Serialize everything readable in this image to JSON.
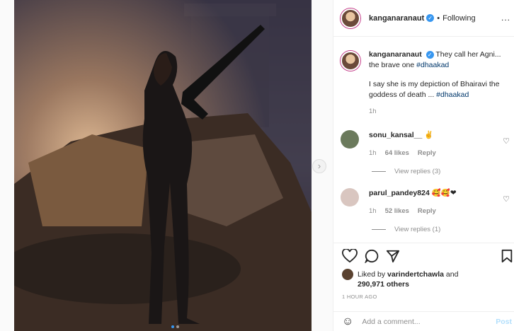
{
  "header": {
    "username": "kanganaranaut",
    "separator": "•",
    "follow_state": "Following",
    "more": "..."
  },
  "caption": {
    "username": "kanganaranaut",
    "text1": "They call her Agni... the brave one",
    "hashtag1": "#dhaakad",
    "text2": "I say she is my depiction of Bhairavi the goddess of death ...",
    "hashtag2": "#dhaakad",
    "time": "1h"
  },
  "comments": [
    {
      "username": "sonu_kansal__",
      "emoji": "✌",
      "time": "1h",
      "likes": "64 likes",
      "reply": "Reply",
      "view_replies": "View replies (3)"
    },
    {
      "username": "parul_pandey824",
      "emoji": "🥰🥰❤",
      "time": "1h",
      "likes": "52 likes",
      "reply": "Reply",
      "view_replies": "View replies (1)"
    }
  ],
  "likes": {
    "prefix": "Liked by",
    "user": "varindertchawla",
    "joiner": "and",
    "count": "290,971 others"
  },
  "timestamp": "1 HOUR AGO",
  "add_comment": {
    "emoji_icon": "☺",
    "placeholder": "Add a comment...",
    "post": "Post"
  },
  "colors": {
    "accent": "#3897f0",
    "hashtag": "#00376b",
    "muted": "#8e8e8e"
  }
}
